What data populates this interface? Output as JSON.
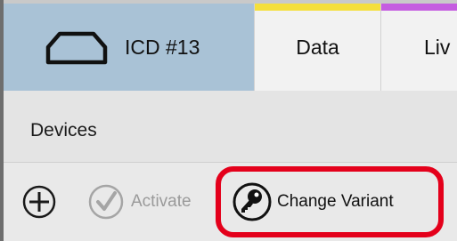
{
  "tabs": [
    {
      "label": "ICD #13",
      "icon": "device-shape-icon",
      "accent": ""
    },
    {
      "label": "Data",
      "accent": "#f5df3b"
    },
    {
      "label": "Liv",
      "accent": "#c55de0"
    }
  ],
  "section": {
    "title": "Devices"
  },
  "toolbar": {
    "add_icon": "circle-plus-icon",
    "activate_label": "Activate",
    "activate_icon": "check-circle-icon",
    "change_variant_label": "Change Variant",
    "change_variant_icon": "key-icon"
  },
  "colors": {
    "active_tab": "#a9c2d6",
    "highlight": "#e4001b"
  }
}
